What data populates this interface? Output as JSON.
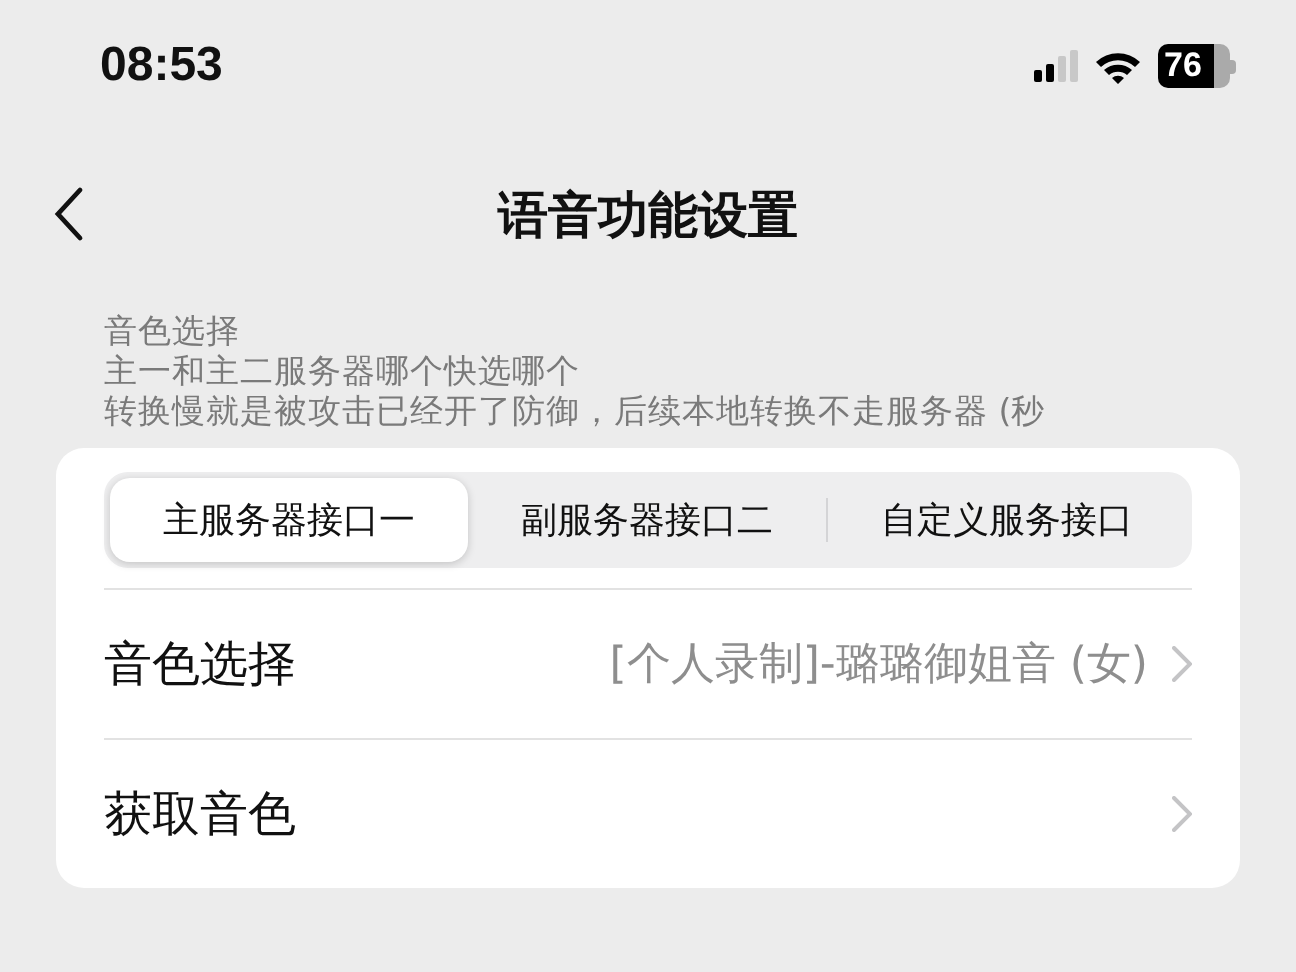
{
  "status_bar": {
    "time": "08:53",
    "battery": "76"
  },
  "nav": {
    "title": "语音功能设置"
  },
  "notes": [
    "音色选择",
    "主一和主二服务器哪个快选哪个",
    "转换慢就是被攻击已经开了防御，后续本地转换不走服务器 (秒"
  ],
  "segments": [
    {
      "label": "主服务器接口一",
      "selected": true
    },
    {
      "label": "副服务器接口二",
      "selected": false
    },
    {
      "label": "自定义服务接口",
      "selected": false
    }
  ],
  "rows": [
    {
      "label": "音色选择",
      "value": "[个人录制]-璐璐御姐音 (女)"
    },
    {
      "label": "获取音色"
    }
  ]
}
